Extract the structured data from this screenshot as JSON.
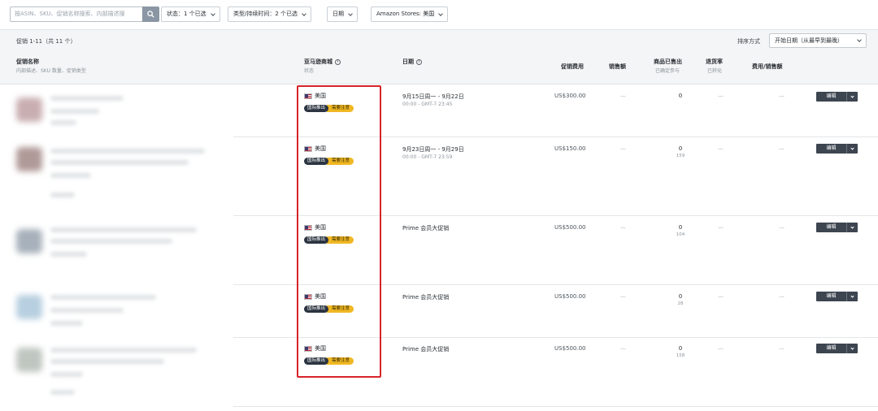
{
  "toolbar": {
    "search_placeholder": "按ASIN、SKU、促销名称搜索、内部描述搜",
    "filters": [
      {
        "label": "状态：1 个已选"
      },
      {
        "label": "类型/持续时间：2 个已选"
      },
      {
        "label": "日期"
      },
      {
        "label": "Amazon Stores: 美国"
      }
    ]
  },
  "summary": {
    "result_count": "促销 1-11（共 11 个）",
    "sort_label": "排序方式",
    "sort_value": "开始日期（从最早到最晚）"
  },
  "columns": {
    "promo_name": "促销名称",
    "promo_name_sub": "内部描述、SKU 数量、促销类型",
    "marketplace": "亚马逊商城",
    "marketplace_sub": "状态",
    "date": "日期",
    "fee": "促销费用",
    "sales": "销售额",
    "units_sold": "商品已售出",
    "units_sold_sub": "已确定参与",
    "return_rate": "退货率",
    "return_rate_sub": "已转化",
    "fee_sales": "费用/销售额"
  },
  "rows": [
    {
      "market": "美国",
      "badge_type": "国际推出",
      "badge_status": "需要注意",
      "date_main": "9月15日周一 - 9月22日",
      "date_sub": "00:00 - GMT-7 23:45",
      "fee": "US$300.00",
      "sales": "—",
      "units": "0",
      "units_sub": "",
      "return_rate": "—",
      "fee_sales": "—",
      "edit": "编辑"
    },
    {
      "market": "美国",
      "badge_type": "国际推出",
      "badge_status": "需要注意",
      "date_main": "9月23日周一 - 9月29日",
      "date_sub": "00:00 - GMT-7 23:59",
      "fee": "US$150.00",
      "sales": "—",
      "units": "0",
      "units_sub": "159",
      "return_rate": "—",
      "fee_sales": "—",
      "edit": "编辑"
    },
    {
      "market": "美国",
      "badge_type": "国际推出",
      "badge_status": "需要注意",
      "date_main": "Prime 会员大促销",
      "date_sub": "",
      "fee": "US$500.00",
      "sales": "—",
      "units": "0",
      "units_sub": "104",
      "return_rate": "—",
      "fee_sales": "—",
      "edit": "编辑"
    },
    {
      "market": "美国",
      "badge_type": "国际推出",
      "badge_status": "需要注意",
      "date_main": "Prime 会员大促销",
      "date_sub": "",
      "fee": "US$500.00",
      "sales": "—",
      "units": "0",
      "units_sub": "28",
      "return_rate": "—",
      "fee_sales": "—",
      "edit": "编辑"
    },
    {
      "market": "美国",
      "badge_type": "国际推出",
      "badge_status": "需要注意",
      "date_main": "Prime 会员大促销",
      "date_sub": "",
      "fee": "US$500.00",
      "sales": "—",
      "units": "0",
      "units_sub": "158",
      "return_rate": "—",
      "fee_sales": "—",
      "edit": "编辑"
    }
  ],
  "colors": {
    "highlight": "#d8232a",
    "badge_dark": "#2b3440",
    "badge_yellow": "#f0b823",
    "edit_button": "#3c4550"
  },
  "icons": [
    "search-icon",
    "chevron-down-icon",
    "info-icon",
    "us-flag-icon"
  ]
}
